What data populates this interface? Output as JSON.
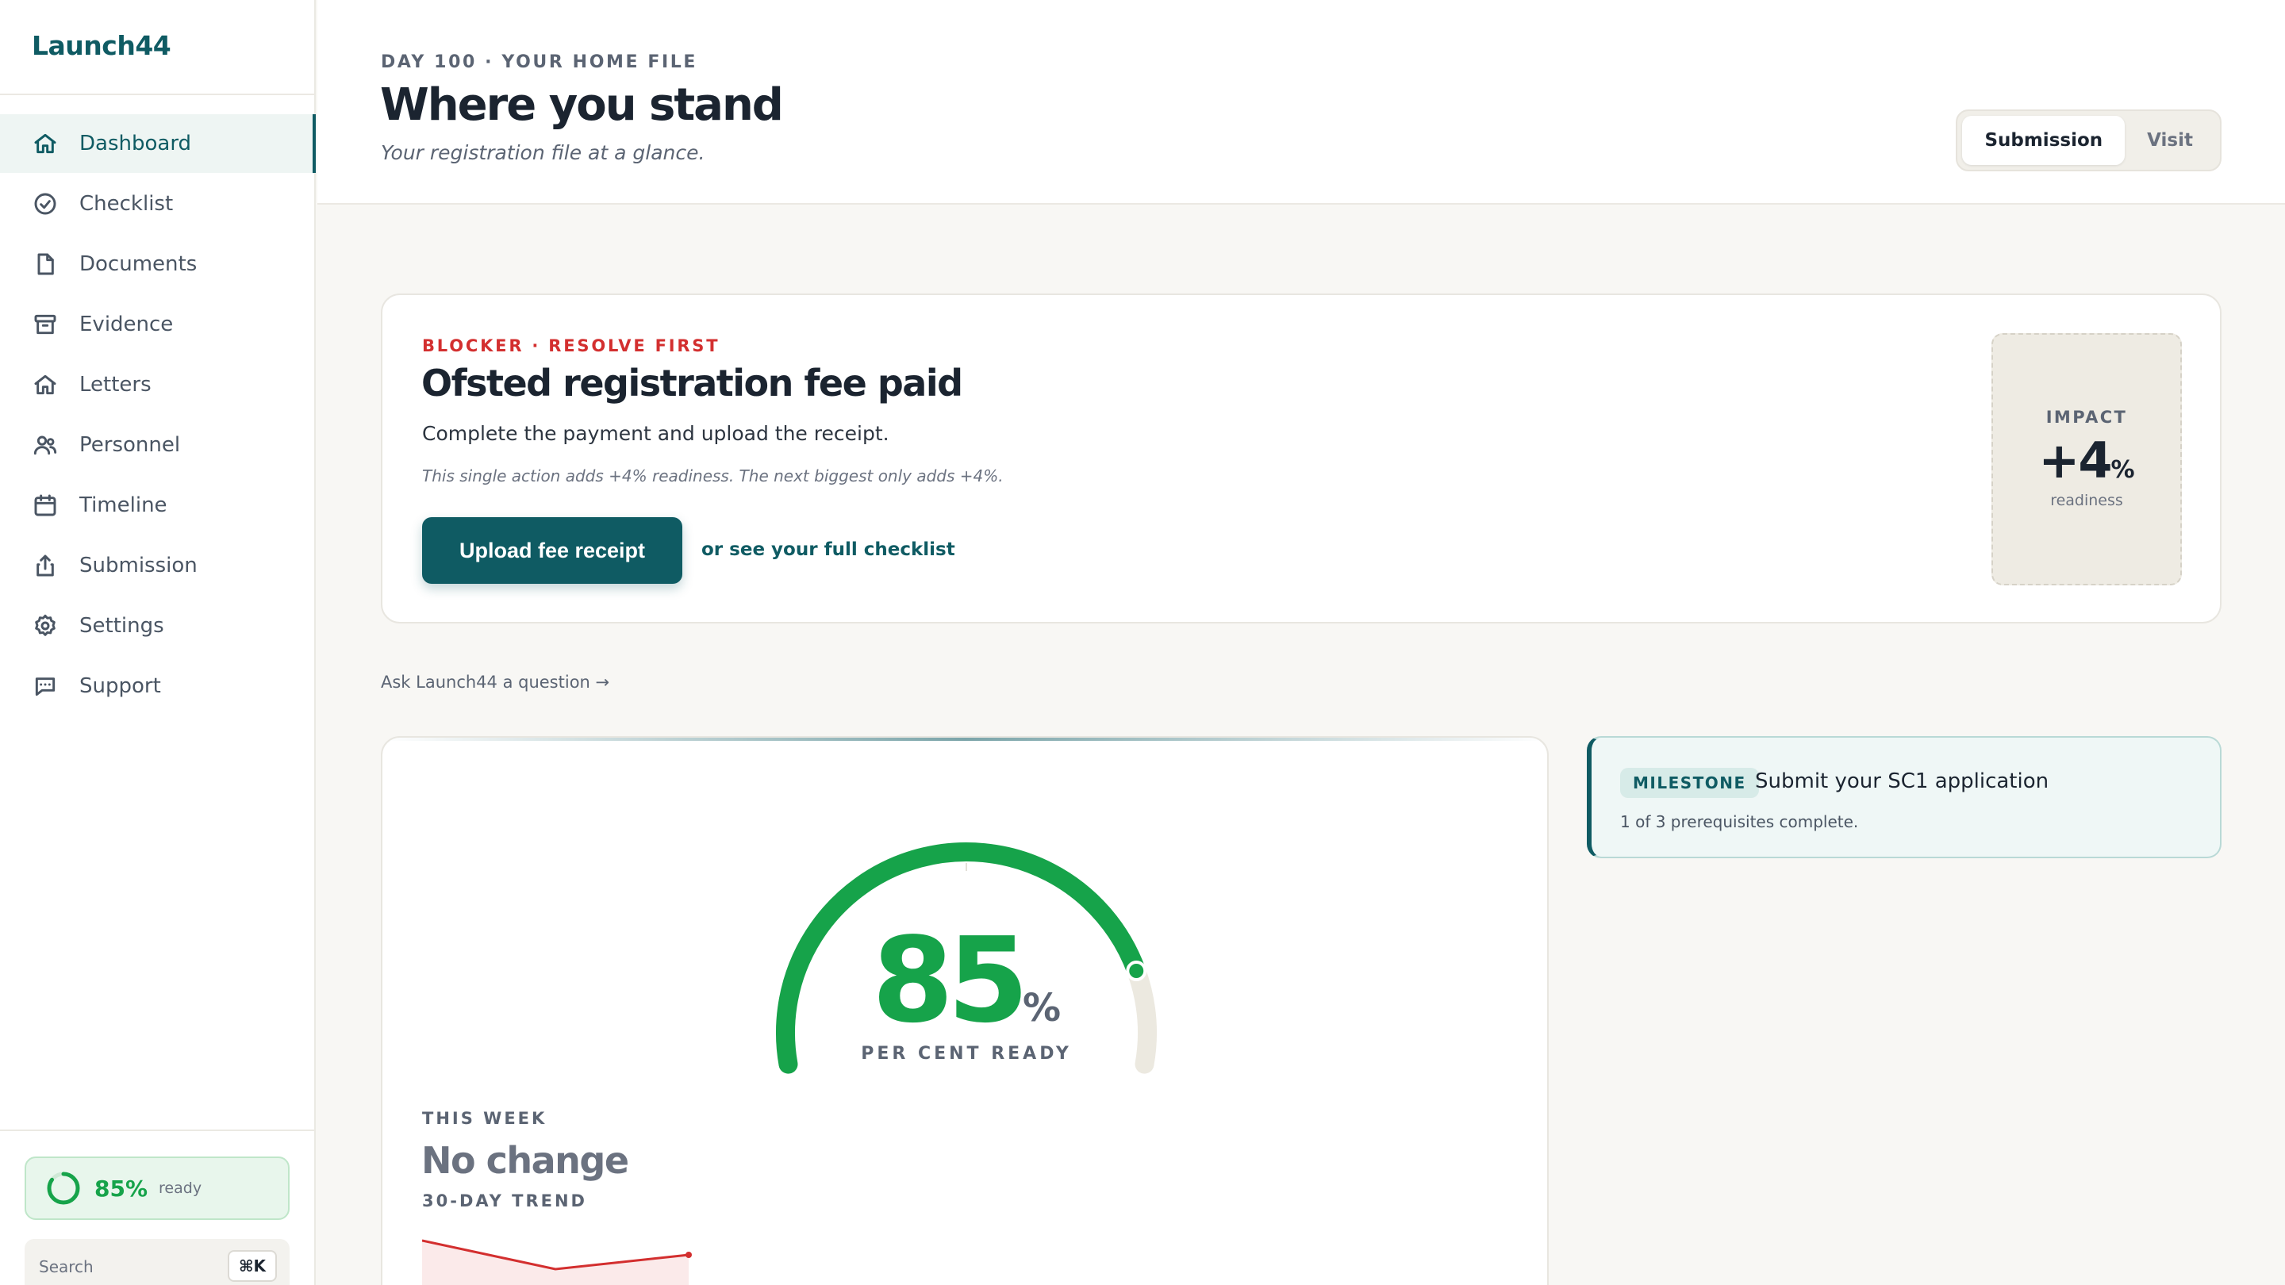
{
  "brand": "Launch44",
  "sidebar": {
    "items": [
      {
        "label": "Dashboard",
        "icon": "home-icon",
        "active": true
      },
      {
        "label": "Checklist",
        "icon": "check-circle-icon"
      },
      {
        "label": "Documents",
        "icon": "document-icon"
      },
      {
        "label": "Evidence",
        "icon": "archive-icon"
      },
      {
        "label": "Letters",
        "icon": "home-icon"
      },
      {
        "label": "Personnel",
        "icon": "users-icon"
      },
      {
        "label": "Timeline",
        "icon": "calendar-icon"
      },
      {
        "label": "Submission",
        "icon": "share-upload-icon"
      },
      {
        "label": "Settings",
        "icon": "gear-icon"
      },
      {
        "label": "Support",
        "icon": "chat-icon"
      }
    ],
    "ready": {
      "value": "85%",
      "label": "ready",
      "fraction": 0.85
    },
    "search": {
      "placeholder": "Search",
      "shortcut": "⌘K"
    }
  },
  "header": {
    "eyebrow": "DAY 100 · YOUR HOME FILE",
    "title": "Where you stand",
    "subtitle": "Your registration file at a glance.",
    "segments": [
      {
        "label": "Submission",
        "active": true
      },
      {
        "label": "Visit",
        "active": false
      }
    ]
  },
  "blocker": {
    "eyebrow": "BLOCKER · RESOLVE FIRST",
    "title": "Ofsted registration fee paid",
    "description": "Complete the payment and upload the receipt.",
    "note": "This single action adds +4% readiness. The next biggest only adds +4%.",
    "primary_button": "Upload fee receipt",
    "secondary_link": "or see your full checklist",
    "impact": {
      "label": "IMPACT",
      "value": "+4",
      "unit": "%",
      "sub": "readiness"
    }
  },
  "ask_link": "Ask Launch44 a question →",
  "readiness": {
    "value": "85",
    "unit": "%",
    "fraction": 0.85,
    "caption": "PER CENT READY",
    "week_eyebrow": "THIS WEEK",
    "week_value": "No change",
    "trend_eyebrow": "30-DAY TREND",
    "trend_values": [
      87,
      85,
      86
    ]
  },
  "milestone": {
    "badge": "MILESTONE",
    "title": "Submit your SC1 application",
    "subtitle": "1 of 3 prerequisites complete."
  },
  "colors": {
    "brand": "#0f5b63",
    "accent_green": "#16a34a",
    "blocker_red": "#d32f2f",
    "trend_red": "#d32f2f"
  }
}
